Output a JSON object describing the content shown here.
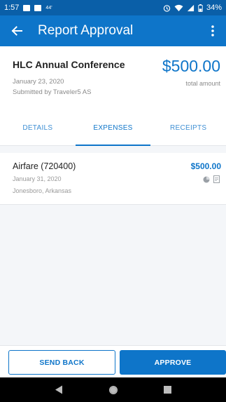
{
  "status_bar": {
    "time": "1:57",
    "small_label": "44'",
    "battery": "34%"
  },
  "app_bar": {
    "title": "Report Approval",
    "back_icon": "arrow-left-icon",
    "menu_icon": "more-vertical-icon"
  },
  "report": {
    "name": "HLC Annual Conference",
    "date": "January 23, 2020",
    "submitted_by": "Submitted by Traveler5 AS",
    "amount": "$500.00",
    "amount_label": "total amount"
  },
  "tabs": [
    {
      "label": "DETAILS",
      "active": false
    },
    {
      "label": "EXPENSES",
      "active": true
    },
    {
      "label": "RECEIPTS",
      "active": false
    }
  ],
  "expenses": [
    {
      "name": "Airfare (720400)",
      "date": "January 31, 2020",
      "location": "Jonesboro, Arkansas",
      "amount": "$500.00",
      "icons": [
        "pie-chart-icon",
        "receipt-icon"
      ]
    }
  ],
  "actions": {
    "send_back": "SEND BACK",
    "approve": "APPROVE"
  },
  "colors": {
    "primary": "#0e75c9",
    "status_bar": "#0a5fa8"
  }
}
